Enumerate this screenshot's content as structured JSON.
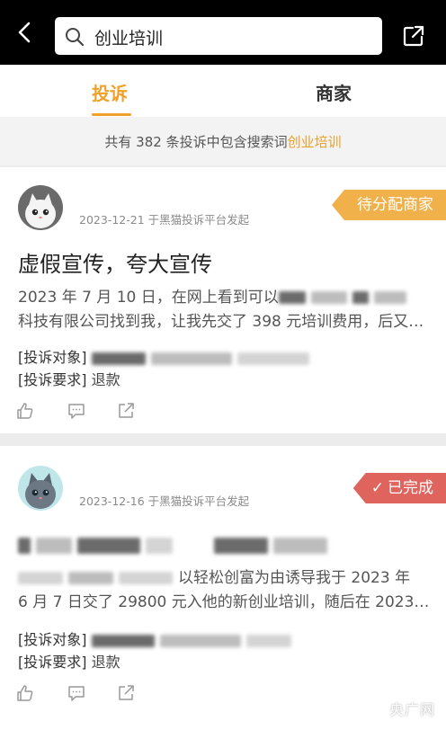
{
  "header": {
    "back_icon": "chevron-left-icon",
    "search_value": "创业培训",
    "share_icon": "external-link-icon"
  },
  "tabs": [
    {
      "label": "投诉",
      "active": true
    },
    {
      "label": "商家",
      "active": false
    }
  ],
  "summary": {
    "prefix": "共有 382 条投诉中包含搜索词",
    "keyword": "创业培训"
  },
  "complaints": [
    {
      "date": "2023-12-21 于黑猫投诉平台发起",
      "status": "待分配商家",
      "status_color": "#f0b14a",
      "title": "虚假宣传，夸大宣传",
      "body_line1": "2023 年 7 月 10 日，在网上看到可以",
      "body_line2": "科技有限公司找到我，让我先交了 398 元培训费用，后又…",
      "target_label": "[投诉对象]",
      "request_label": "[投诉要求]",
      "request_value": "退款"
    },
    {
      "date": "2023-12-16 于黑猫投诉平台发起",
      "status": "已完成",
      "status_color": "#e0645e",
      "body_line1_tail": "以轻松创富为由诱导我于 2023 年",
      "body_line2": "6 月 7 日交了 29800 元入他的新创业培训，随后在 2023…",
      "target_label": "[投诉对象]",
      "request_label": "[投诉要求]",
      "request_value": "退款"
    }
  ],
  "watermark": "央广网"
}
